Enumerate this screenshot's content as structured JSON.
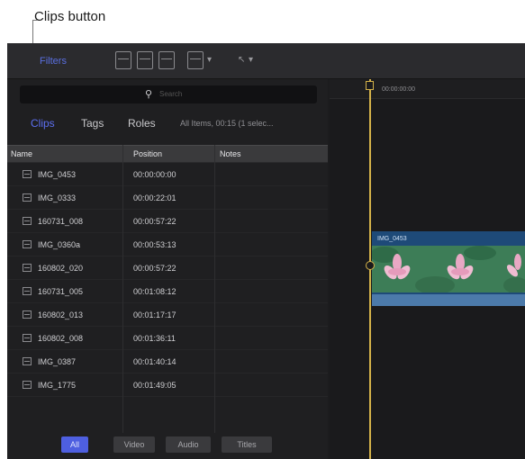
{
  "callout": {
    "label": "Clips button"
  },
  "toolbar": {
    "left_label": "Filters"
  },
  "browser": {
    "search_placeholder": "Search",
    "filters": {
      "clips": "Clips",
      "tags": "Tags",
      "roles": "Roles",
      "summary": "All Items, 00:15 (1 selec..."
    },
    "columns": {
      "name": "Name",
      "position": "Position",
      "notes": "Notes"
    },
    "rows": [
      {
        "name": "IMG_0453",
        "position": "00:00:00:00"
      },
      {
        "name": "IMG_0333",
        "position": "00:00:22:01"
      },
      {
        "name": "160731_008",
        "position": "00:00:57:22"
      },
      {
        "name": "IMG_0360a",
        "position": "00:00:53:13"
      },
      {
        "name": "160802_020",
        "position": "00:00:57:22"
      },
      {
        "name": "160731_005",
        "position": "00:01:08:12"
      },
      {
        "name": "160802_013",
        "position": "00:01:17:17"
      },
      {
        "name": "160802_008",
        "position": "00:01:36:11"
      },
      {
        "name": "IMG_0387",
        "position": "00:01:40:14"
      },
      {
        "name": "IMG_1775",
        "position": "00:01:49:05"
      }
    ],
    "bottom_tabs": {
      "all": "All",
      "video": "Video",
      "audio": "Audio",
      "titles": "Titles"
    }
  },
  "timeline": {
    "timecode": "00:00:00:00",
    "clip_name": "IMG_0453"
  },
  "colors": {
    "accent": "#5c6ff0",
    "playhead": "#d4b24a",
    "clip": "#1e4a78"
  }
}
